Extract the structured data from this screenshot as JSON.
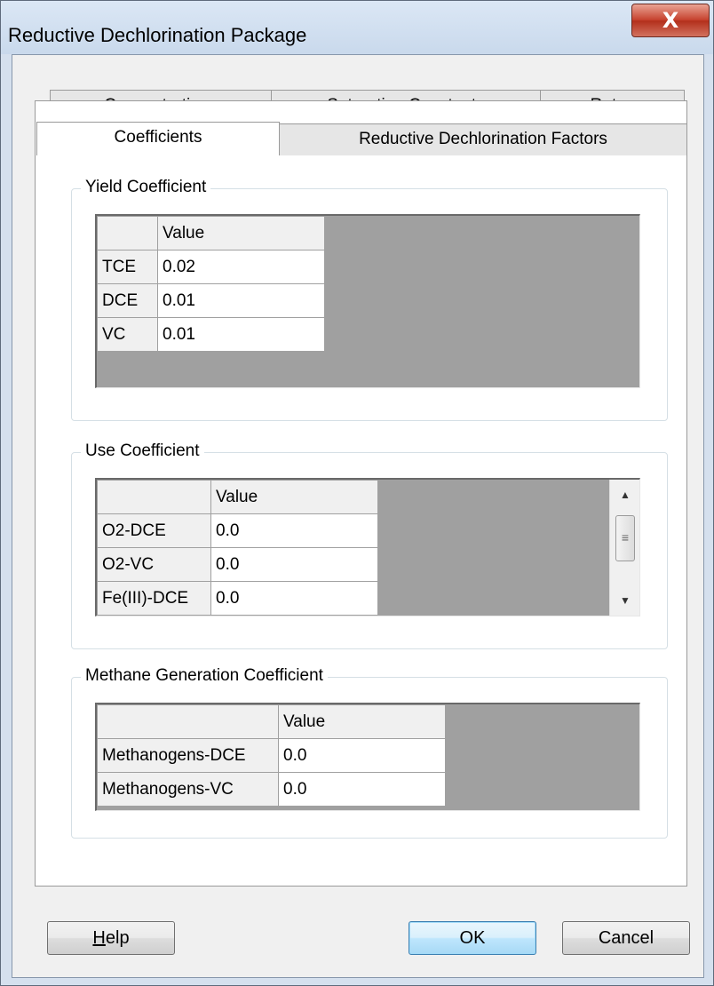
{
  "window": {
    "title": "Reductive Dechlorination Package",
    "close_glyph": "X"
  },
  "tabs": {
    "row_back": [
      "Concentrations",
      "Saturation Constants",
      "Rates"
    ],
    "row_front": [
      "Coefficients",
      "Reductive Dechlorination Factors"
    ],
    "active": "Coefficients"
  },
  "yield": {
    "label": "Yield Coefficient",
    "header": "Value",
    "rows": [
      {
        "name": "TCE",
        "value": "0.02"
      },
      {
        "name": "DCE",
        "value": "0.01"
      },
      {
        "name": "VC",
        "value": "0.01"
      }
    ]
  },
  "use": {
    "label": "Use Coefficient",
    "header": "Value",
    "rows": [
      {
        "name": "O2-DCE",
        "value": "0.0"
      },
      {
        "name": "O2-VC",
        "value": "0.0"
      },
      {
        "name": "Fe(III)-DCE",
        "value": "0.0"
      }
    ],
    "scroll_icons": [
      "scroll-up-arrow-icon",
      "scroll-grip-icon",
      "scroll-down-arrow-icon"
    ]
  },
  "methane": {
    "label": "Methane Generation Coefficient",
    "header": "Value",
    "rows": [
      {
        "name": "Methanogens-DCE",
        "value": "0.0"
      },
      {
        "name": "Methanogens-VC",
        "value": "0.0"
      }
    ]
  },
  "buttons": {
    "help": "Help",
    "help_mnemonic": "H",
    "help_rest": "elp",
    "ok": "OK",
    "cancel": "Cancel"
  },
  "colors": {
    "grid_background": "#a0a0a0",
    "close_button": "#c7432f",
    "window_frame": "#d5e0ee"
  }
}
